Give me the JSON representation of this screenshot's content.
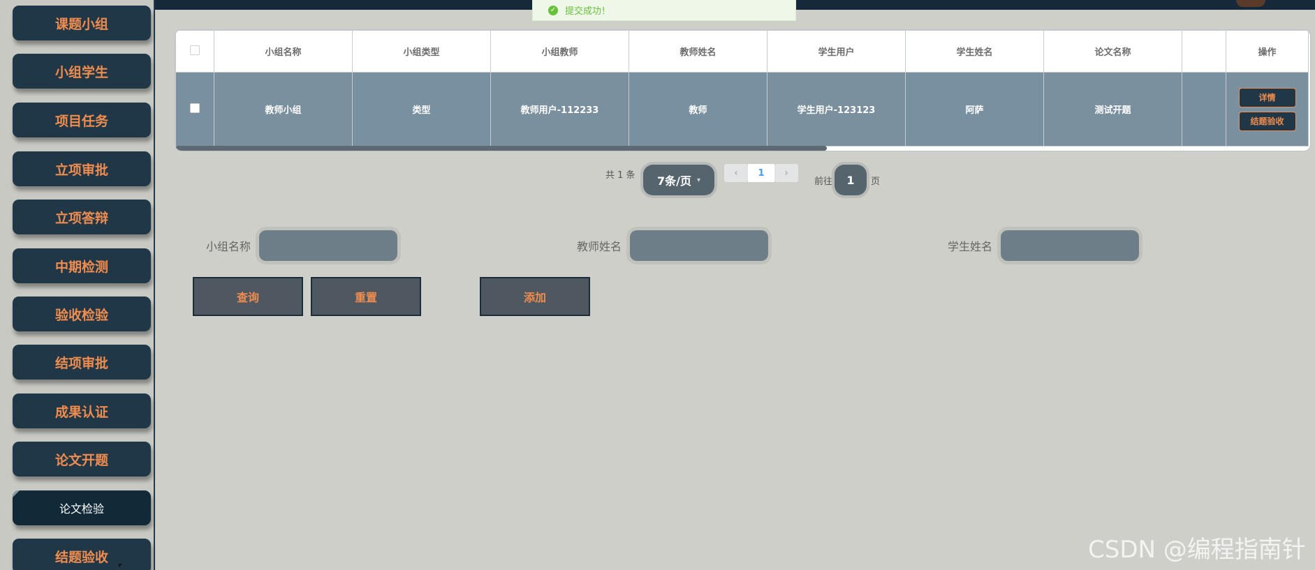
{
  "sidebar": {
    "items": [
      {
        "label": "课题小组"
      },
      {
        "label": "小组学生"
      },
      {
        "label": "项目任务"
      },
      {
        "label": "立项审批"
      },
      {
        "label": "立项答辩"
      },
      {
        "label": "中期检测"
      },
      {
        "label": "验收检验"
      },
      {
        "label": "结项审批"
      },
      {
        "label": "成果认证"
      },
      {
        "label": "论文开题"
      },
      {
        "label": "论文检验"
      },
      {
        "label": "结题验收"
      }
    ],
    "active_index": 10
  },
  "toast": {
    "icon": "check-circle-icon",
    "message": "提交成功！",
    "color": "#67c23a"
  },
  "table": {
    "headers": [
      "小组名称",
      "小组类型",
      "小组教师",
      "教师姓名",
      "学生用户",
      "学生姓名",
      "论文名称",
      "",
      "操作"
    ],
    "rows": [
      {
        "cells": [
          "教师小组",
          "类型",
          "教师用户-112233",
          "教师",
          "学生用户-123123",
          "阿萨",
          "测试开题",
          ""
        ],
        "actions": [
          "详情",
          "结题验收"
        ]
      }
    ]
  },
  "pagination": {
    "total": "共 1 条",
    "page_size": "7条/页",
    "current_page": "1",
    "goto_label": "前往",
    "goto_value": "1",
    "page_suffix": "页"
  },
  "search": {
    "group_name_label": "小组名称",
    "teacher_name_label": "教师姓名",
    "student_name_label": "学生姓名",
    "group_name_value": "",
    "teacher_name_value": "",
    "student_name_value": ""
  },
  "buttons": {
    "query": "查询",
    "reset": "重置",
    "add": "添加"
  },
  "watermark": "CSDN @编程指南针",
  "colors": {
    "accent": "#f08c4e",
    "sidebar_bg": "#1f3747",
    "row_bg": "#7a909f",
    "success": "#67c23a"
  }
}
